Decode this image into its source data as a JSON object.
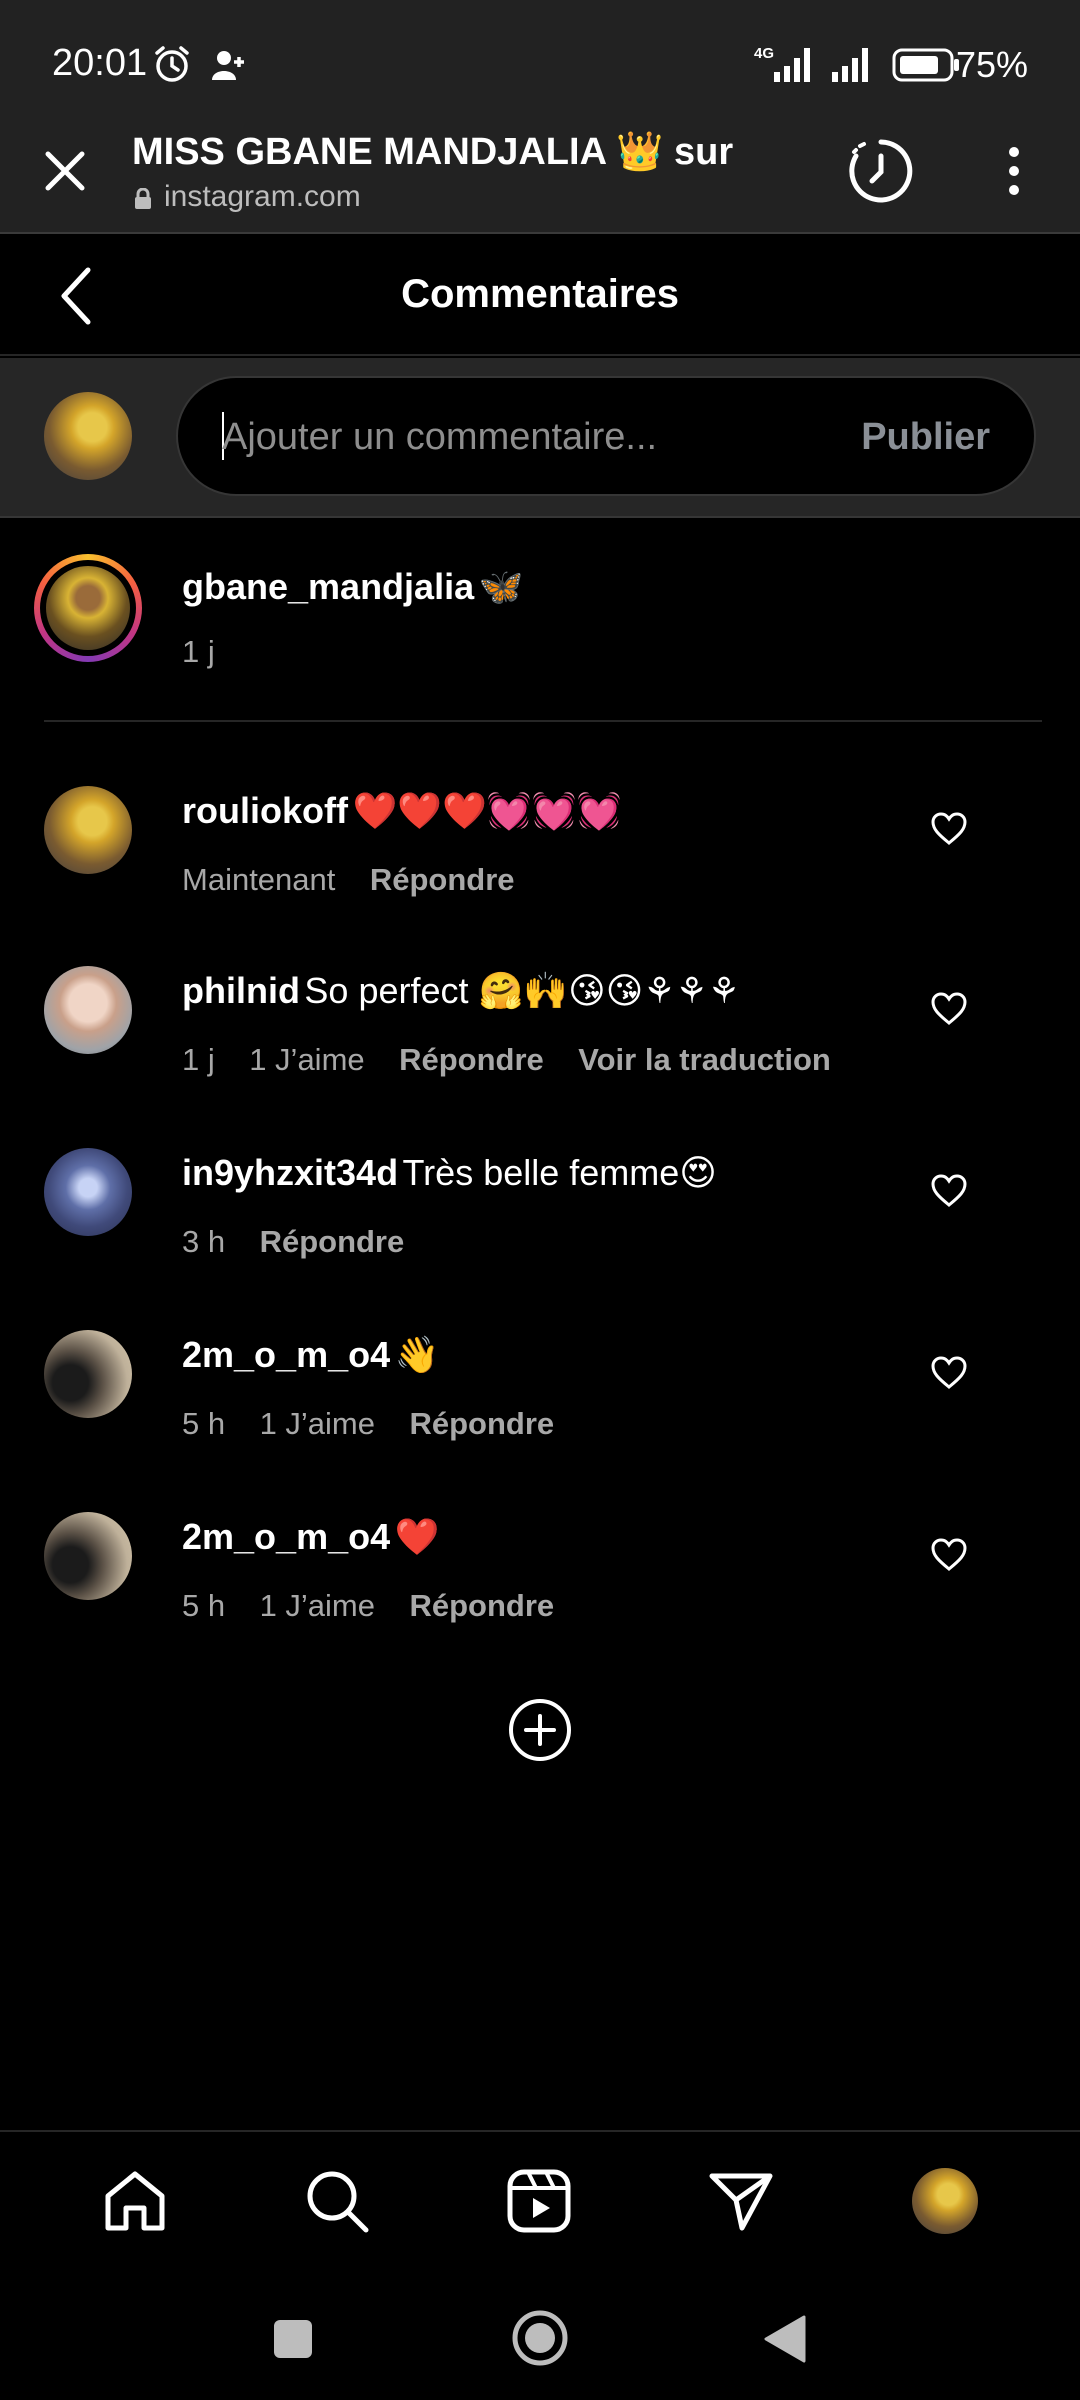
{
  "status": {
    "time": "20:01",
    "network": "4G",
    "battery": "75%"
  },
  "browser": {
    "title": "MISS GBANE MANDJALIA 👑 sur",
    "url": "instagram.com"
  },
  "header": {
    "title": "Commentaires"
  },
  "composer": {
    "placeholder": "Ajouter un commentaire...",
    "publish_label": "Publier"
  },
  "post": {
    "username": "gbane_mandjalia",
    "caption": "🦋",
    "time": "1 j"
  },
  "comments": [
    {
      "username": "rouliokoff",
      "text": "❤️❤️❤️💓💓💓",
      "time": "Maintenant",
      "likes": "",
      "reply": "Répondre",
      "translate": ""
    },
    {
      "username": "philnid",
      "text": "So perfect 🤗🙌😘😘⚘⚘⚘",
      "time": "1 j",
      "likes": "1 J’aime",
      "reply": "Répondre",
      "translate": "Voir la traduction"
    },
    {
      "username": "in9yhzxit34d",
      "text": "Très belle femme😍",
      "time": "3 h",
      "likes": "",
      "reply": "Répondre",
      "translate": ""
    },
    {
      "username": "2m_o_m_o4",
      "text": "👋",
      "time": "5 h",
      "likes": "1 J’aime",
      "reply": "Répondre",
      "translate": ""
    },
    {
      "username": "2m_o_m_o4",
      "text": "❤️",
      "time": "5 h",
      "likes": "1 J’aime",
      "reply": "Répondre",
      "translate": ""
    }
  ],
  "icons": {
    "close": "close-icon",
    "history": "history-icon",
    "menu": "more-vertical-icon",
    "back": "chevron-left-icon",
    "heart": "heart-outline-icon",
    "load_more": "plus-circle-icon",
    "nav": [
      "home-icon",
      "search-icon",
      "reels-icon",
      "send-icon",
      "profile-avatar"
    ]
  }
}
